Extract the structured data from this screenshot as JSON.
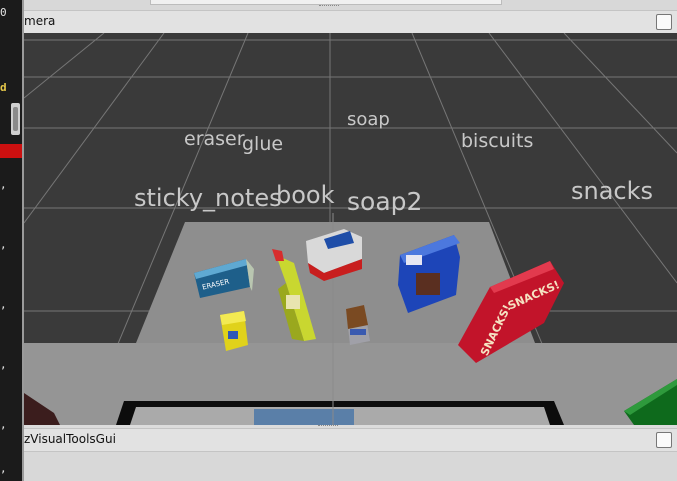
{
  "left_strip": {
    "fragments": [
      "0",
      "d",
      ",",
      ",",
      ",",
      ",",
      ",",
      ","
    ]
  },
  "camera_panel": {
    "title": "mera"
  },
  "scene_labels": {
    "eraser": "eraser",
    "glue": "glue",
    "soap": "soap",
    "biscuits": "biscuits",
    "sticky_notes": "sticky_notes",
    "book": "book",
    "soap2": "soap2",
    "snacks": "snacks"
  },
  "box_texts": {
    "eraser": "ERASER",
    "snacks_a": "SNACKS!",
    "snacks_b": "SNACKS!"
  },
  "tools_panel": {
    "title": "zVisualToolsGui"
  },
  "colors": {
    "viewport_bg": "#3a3a3a",
    "table": "#8e8e8e",
    "grid": "#777777",
    "label": "#c8c8c8"
  }
}
